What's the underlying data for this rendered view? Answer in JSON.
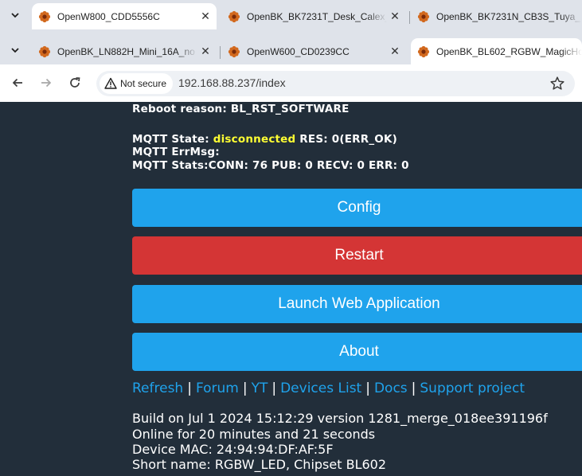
{
  "browser": {
    "tabs_row1": [
      {
        "title": "OpenW800_CDD5556C",
        "active": true
      },
      {
        "title": "OpenBK_BK7231T_Desk_Calex_",
        "active": false
      },
      {
        "title": "OpenBK_BK7231N_CB3S_Tuya_",
        "active": false
      }
    ],
    "tabs_row2": [
      {
        "title": "OpenBK_LN882H_Mini_16A_no",
        "active": false
      },
      {
        "title": "OpenW600_CD0239CC",
        "active": false
      },
      {
        "title": "OpenBK_BL602_RGBW_MagicHo",
        "active": true
      }
    ],
    "security_label": "Not secure",
    "url": "192.168.88.237/index",
    "close_glyph": "✕"
  },
  "status": {
    "reboot_reason": "Reboot reason: BL_RST_SOFTWARE",
    "mqtt_state_label": "MQTT State: ",
    "mqtt_state_value": "disconnected",
    "mqtt_res": " RES: 0(ERR_OK)",
    "mqtt_errmsg": "MQTT ErrMsg:",
    "mqtt_stats": "MQTT Stats:CONN: 76 PUB: 0 RECV: 0 ERR: 0"
  },
  "buttons": {
    "config": "Config",
    "restart": "Restart",
    "launch_web_app": "Launch Web Application",
    "about": "About"
  },
  "links": {
    "refresh": "Refresh",
    "forum": "Forum",
    "yt": "YT",
    "devices_list": "Devices List",
    "docs": "Docs",
    "support_project": "Support project",
    "separator": "|"
  },
  "device_info": {
    "build": "Build on Jul 1 2024 15:12:29 version 1281_merge_018ee391196f",
    "online": "Online for 20 minutes and 21 seconds",
    "mac": "Device MAC: 24:94:94:DF:AF:5F",
    "short_name": "Short name: RGBW_LED, Chipset BL602"
  },
  "colors": {
    "page_bg": "#222e3a",
    "button_blue": "#1fa3ec",
    "button_red": "#d43535",
    "link": "#1fa3ec",
    "highlight": "#ffff33"
  },
  "icons": {
    "favicon": "openbk-flower-icon",
    "back": "back-arrow-icon",
    "forward": "forward-arrow-icon",
    "reload": "reload-icon",
    "warning": "warning-triangle-icon",
    "bookmark": "star-icon",
    "tab_search": "chevron-down-icon"
  }
}
